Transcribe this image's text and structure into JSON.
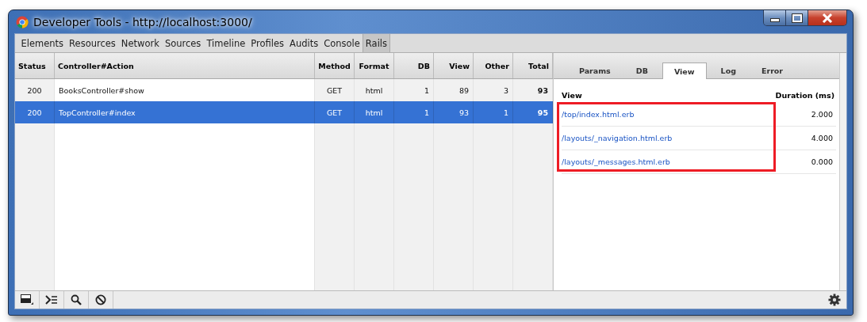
{
  "window": {
    "title": "Developer Tools - http://localhost:3000/"
  },
  "panel_tabs": [
    {
      "label": "Elements",
      "selected": false
    },
    {
      "label": "Resources",
      "selected": false
    },
    {
      "label": "Network",
      "selected": false
    },
    {
      "label": "Sources",
      "selected": false
    },
    {
      "label": "Timeline",
      "selected": false
    },
    {
      "label": "Profiles",
      "selected": false
    },
    {
      "label": "Audits",
      "selected": false
    },
    {
      "label": "Console",
      "selected": false
    },
    {
      "label": "Rails",
      "selected": true
    }
  ],
  "requests": {
    "columns": [
      "Status",
      "Controller#Action",
      "Method",
      "Format",
      "DB",
      "View",
      "Other",
      "Total"
    ],
    "rows": [
      {
        "cells": [
          "200",
          "BooksController#show",
          "GET",
          "html",
          "1",
          "89",
          "3",
          "93"
        ],
        "selected": false
      },
      {
        "cells": [
          "200",
          "TopController#index",
          "GET",
          "html",
          "1",
          "93",
          "1",
          "95"
        ],
        "selected": true
      }
    ]
  },
  "detail_tabs": [
    {
      "label": "Params",
      "selected": false
    },
    {
      "label": "DB",
      "selected": false
    },
    {
      "label": "View",
      "selected": true
    },
    {
      "label": "Log",
      "selected": false
    },
    {
      "label": "Error",
      "selected": false
    }
  ],
  "views": {
    "columns": [
      "View",
      "Duration (ms)"
    ],
    "rows": [
      {
        "view": "/top/index.html.erb",
        "duration": "2.000"
      },
      {
        "view": "/layouts/_navigation.html.erb",
        "duration": "4.000"
      },
      {
        "view": "/layouts/_messages.html.erb",
        "duration": "0.000"
      }
    ],
    "highlighted": true
  }
}
